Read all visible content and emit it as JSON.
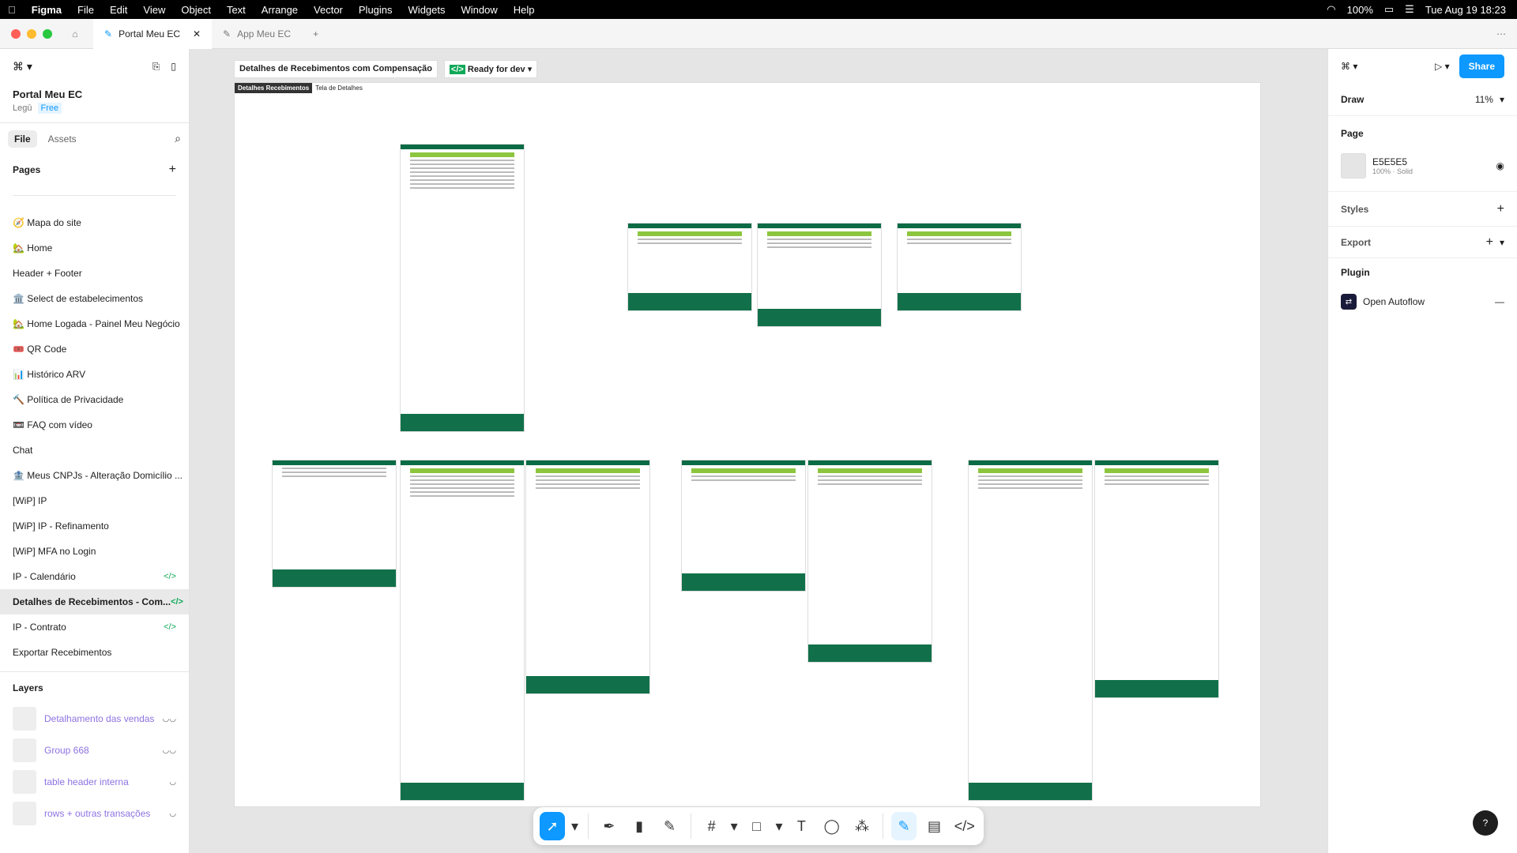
{
  "menubar": {
    "app": "Figma",
    "items": [
      "File",
      "Edit",
      "View",
      "Object",
      "Text",
      "Arrange",
      "Vector",
      "Plugins",
      "Widgets",
      "Window",
      "Help"
    ],
    "battery": "100%",
    "datetime": "Tue Aug 19  18:23"
  },
  "tabs": [
    {
      "label": "Portal Meu EC",
      "active": true
    },
    {
      "label": "App Meu EC",
      "active": false
    }
  ],
  "left": {
    "file_name": "Portal Meu EC",
    "team": "Legū",
    "plan": "Free",
    "panel_tabs": [
      "File",
      "Assets"
    ],
    "pages_title": "Pages",
    "pages": [
      "🧭 Mapa do site",
      "🏡 Home",
      "Header + Footer",
      "🏛️ Select de estabelecimentos",
      "🏡 Home Logada - Painel Meu Negócio",
      "🎟️ QR Code",
      "📊 Histórico ARV",
      "🔨 Política de Privacidade",
      "📼 FAQ com vídeo",
      "Chat",
      "🏦 Meus CNPJs - Alteração Domicílio ...",
      "[WiP] IP",
      "[WiP] IP - Refinamento",
      "[WiP] MFA no Login",
      "IP - Calendário",
      "Detalhes de Recebimentos - Com...",
      "IP - Contrato",
      "Exportar Recebimentos"
    ],
    "selected_page": "Detalhes de Recebimentos - Com...",
    "layers_title": "Layers",
    "layers": [
      "Detalhamento das vendas",
      "Group 668",
      "table header interna",
      "rows + outras transações"
    ]
  },
  "canvas": {
    "frame_title": "Detalhes de Recebimentos com Compensação",
    "status_badge": "Ready for dev",
    "section_label": "Detalhes Recebimentos",
    "section_sub": "Tela de Detalhes"
  },
  "right": {
    "draw": "Draw",
    "zoom": "11%",
    "share": "Share",
    "page": "Page",
    "page_color": "E5E5E5",
    "page_color_sub": "100% · Solid",
    "styles": "Styles",
    "export": "Export",
    "plugin": "Plugin",
    "plugin_item": "Open Autoflow"
  },
  "colors": {
    "accent": "#0d99ff",
    "dev_green": "#0fa958",
    "brand_green": "#0b6b45",
    "lime": "#8cc63f"
  }
}
